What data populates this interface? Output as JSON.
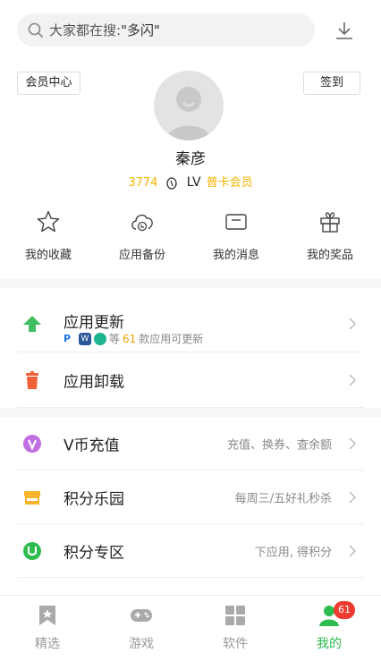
{
  "search": {
    "prefix": "大家都在搜:",
    "keyword": "\"多闪\""
  },
  "header": {
    "vip_center": "会员中心",
    "sign_in": "签到"
  },
  "profile": {
    "name": "秦彦",
    "points": "3774",
    "level": "LV",
    "membership": "普卡会员"
  },
  "quick": [
    {
      "label": "我的收藏",
      "icon": "star-icon"
    },
    {
      "label": "应用备份",
      "icon": "cloud-backup-icon"
    },
    {
      "label": "我的消息",
      "icon": "message-icon"
    },
    {
      "label": "我的奖品",
      "icon": "gift-icon"
    }
  ],
  "list": {
    "update": {
      "title": "应用更新",
      "sub_prefix": "等",
      "count": "61",
      "sub_suffix": "款应用可更新"
    },
    "uninstall": {
      "title": "应用卸载"
    },
    "recharge": {
      "title": "V币充值",
      "hint": "充值、换券、查余额"
    },
    "park": {
      "title": "积分乐园",
      "hint": "每周三/五好礼秒杀"
    },
    "zone": {
      "title": "积分专区",
      "hint": "下应用, 得积分"
    }
  },
  "tabs": [
    {
      "label": "精选"
    },
    {
      "label": "游戏"
    },
    {
      "label": "软件"
    },
    {
      "label": "我的",
      "badge": "61"
    }
  ],
  "colors": {
    "accent": "#2ebc4f",
    "gold": "#f4b400",
    "badge": "#ee3b2f"
  }
}
